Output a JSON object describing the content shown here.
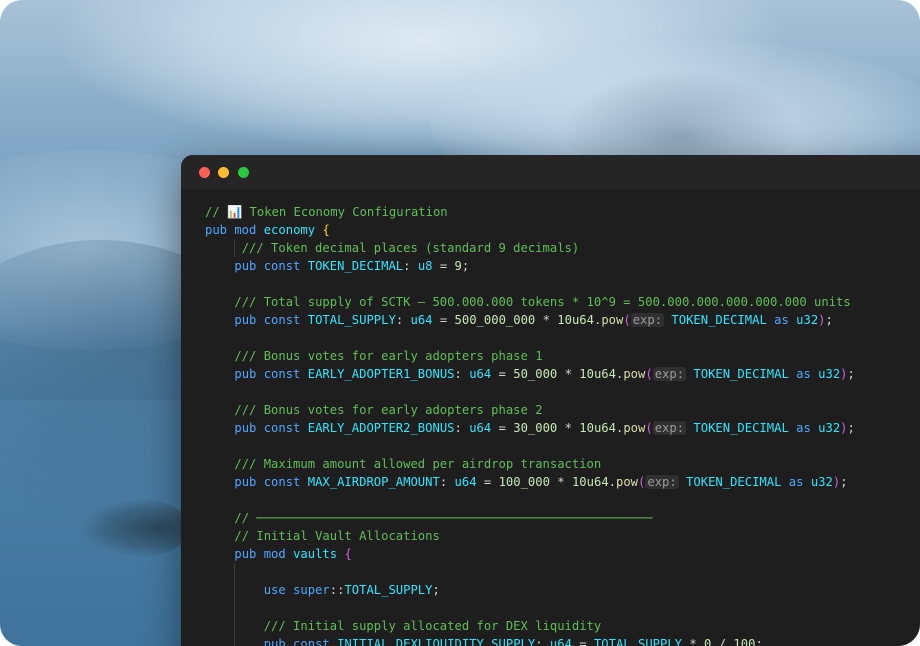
{
  "window": {
    "traffic_lights": [
      "close",
      "minimize",
      "maximize"
    ]
  },
  "code": {
    "l1_comment": "// 📊 Token Economy Configuration",
    "l2_kw": "pub mod",
    "l2_name": "economy",
    "l2_brace": "{",
    "l3_doc": "/// Token decimal places (standard 9 decimals)",
    "l4_kw": "pub const",
    "l4_name": "TOKEN_DECIMAL",
    "l4_colon": ":",
    "l4_type": "u8",
    "l4_eq": "=",
    "l4_val": "9",
    "l4_semi": ";",
    "l6_doc": "/// Total supply of SCTK – 500.000.000 tokens * 10^9 = 500.000.000.000.000.000 units",
    "l7_kw": "pub const",
    "l7_name": "TOTAL_SUPPLY",
    "l7_type": "u64",
    "l7_val": "500_000_000",
    "l7_mul": "*",
    "l7_base": "10u64",
    "l7_fn": "pow",
    "l7_hint": "exp:",
    "l7_arg": "TOKEN_DECIMAL",
    "l7_as": "as",
    "l7_cast": "u32",
    "l9_doc": "/// Bonus votes for early adopters phase 1",
    "l10_kw": "pub const",
    "l10_name": "EARLY_ADOPTER1_BONUS",
    "l10_type": "u64",
    "l10_val": "50_000",
    "l10_base": "10u64",
    "l10_fn": "pow",
    "l10_hint": "exp:",
    "l10_arg": "TOKEN_DECIMAL",
    "l10_as": "as",
    "l10_cast": "u32",
    "l12_doc": "/// Bonus votes for early adopters phase 2",
    "l13_kw": "pub const",
    "l13_name": "EARLY_ADOPTER2_BONUS",
    "l13_type": "u64",
    "l13_val": "30_000",
    "l13_base": "10u64",
    "l13_fn": "pow",
    "l13_hint": "exp:",
    "l13_arg": "TOKEN_DECIMAL",
    "l13_as": "as",
    "l13_cast": "u32",
    "l15_doc": "/// Maximum amount allowed per airdrop transaction",
    "l16_kw": "pub const",
    "l16_name": "MAX_AIRDROP_AMOUNT",
    "l16_type": "u64",
    "l16_val": "100_000",
    "l16_base": "10u64",
    "l16_fn": "pow",
    "l16_hint": "exp:",
    "l16_arg": "TOKEN_DECIMAL",
    "l16_as": "as",
    "l16_cast": "u32",
    "l18_comment": "// ──────────────────────────────────────────────────────",
    "l19_comment": "// Initial Vault Allocations",
    "l20_kw": "pub mod",
    "l20_name": "vaults",
    "l20_brace": "{",
    "l22_kw": "use",
    "l22_super": "super",
    "l22_sep": "::",
    "l22_name": "TOTAL_SUPPLY",
    "l22_semi": ";",
    "l24_doc": "/// Initial supply allocated for DEX liquidity",
    "l25_kw": "pub const",
    "l25_name": "INITIAL_DEXLIQUIDITY_SUPPLY",
    "l25_type": "u64",
    "l25_ref": "TOTAL_SUPPLY",
    "l25_mul": "*",
    "l25_num": "0",
    "l25_div": "/",
    "l25_den": "100",
    "l25_semi": ";"
  },
  "colors": {
    "editor_bg": "#1e1e1e",
    "keyword": "#4fa7ff",
    "constant": "#2ee6ff",
    "comment": "#5fbf55",
    "brace": "#ffd400"
  }
}
